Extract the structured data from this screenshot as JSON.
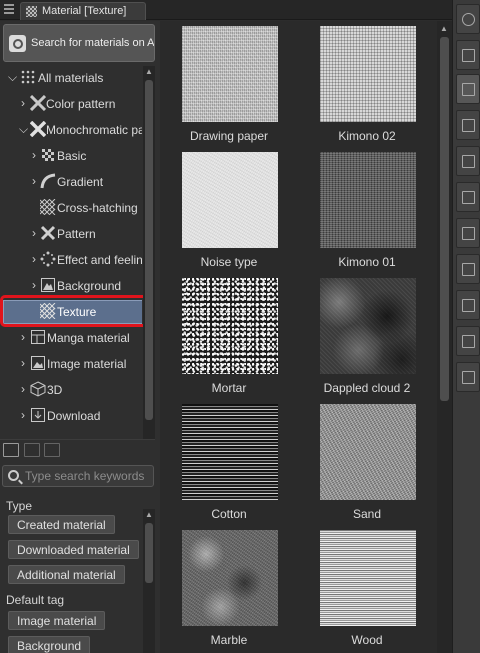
{
  "window": {
    "tab_title": "Material [Texture]"
  },
  "asset_button": {
    "label": "Search for materials on ASSETS"
  },
  "tree": {
    "items": [
      {
        "label": "All materials",
        "icon": "grid-dots-icon",
        "expanded": true
      },
      {
        "label": "Color pattern",
        "icon": "color-pattern-icon"
      },
      {
        "label": "Monochromatic pat",
        "icon": "monochromatic-pattern-icon",
        "expanded": true
      },
      {
        "label": "Basic",
        "icon": "basic-pattern-icon"
      },
      {
        "label": "Gradient",
        "icon": "gradient-icon"
      },
      {
        "label": "Cross-hatching",
        "icon": "cross-hatching-icon"
      },
      {
        "label": "Pattern",
        "icon": "pattern-icon"
      },
      {
        "label": "Effect and feelin",
        "icon": "effect-icon"
      },
      {
        "label": "Background",
        "icon": "background-icon"
      },
      {
        "label": "Texture",
        "icon": "texture-icon",
        "selected": true
      },
      {
        "label": "Manga material",
        "icon": "manga-material-icon"
      },
      {
        "label": "Image material",
        "icon": "image-material-icon"
      },
      {
        "label": "3D",
        "icon": "cube-3d-icon"
      },
      {
        "label": "Download",
        "icon": "download-icon"
      }
    ]
  },
  "search": {
    "placeholder": "Type search keywords"
  },
  "filters": {
    "type_heading": "Type",
    "type_tags": [
      "Created material",
      "Downloaded material",
      "Additional material"
    ],
    "default_tag_heading": "Default tag",
    "default_tags": [
      "Image material",
      "Background"
    ]
  },
  "materials": [
    {
      "name": "Drawing paper"
    },
    {
      "name": "Kimono 02"
    },
    {
      "name": "Noise type"
    },
    {
      "name": "Kimono 01"
    },
    {
      "name": "Mortar"
    },
    {
      "name": "Dappled cloud 2"
    },
    {
      "name": "Cotton"
    },
    {
      "name": "Sand"
    },
    {
      "name": "Marble"
    },
    {
      "name": "Wood"
    }
  ],
  "colors": {
    "selection": "#5c6f8d",
    "highlight_ring": "#e0141c",
    "panel_bg": "#2f2f2f"
  }
}
